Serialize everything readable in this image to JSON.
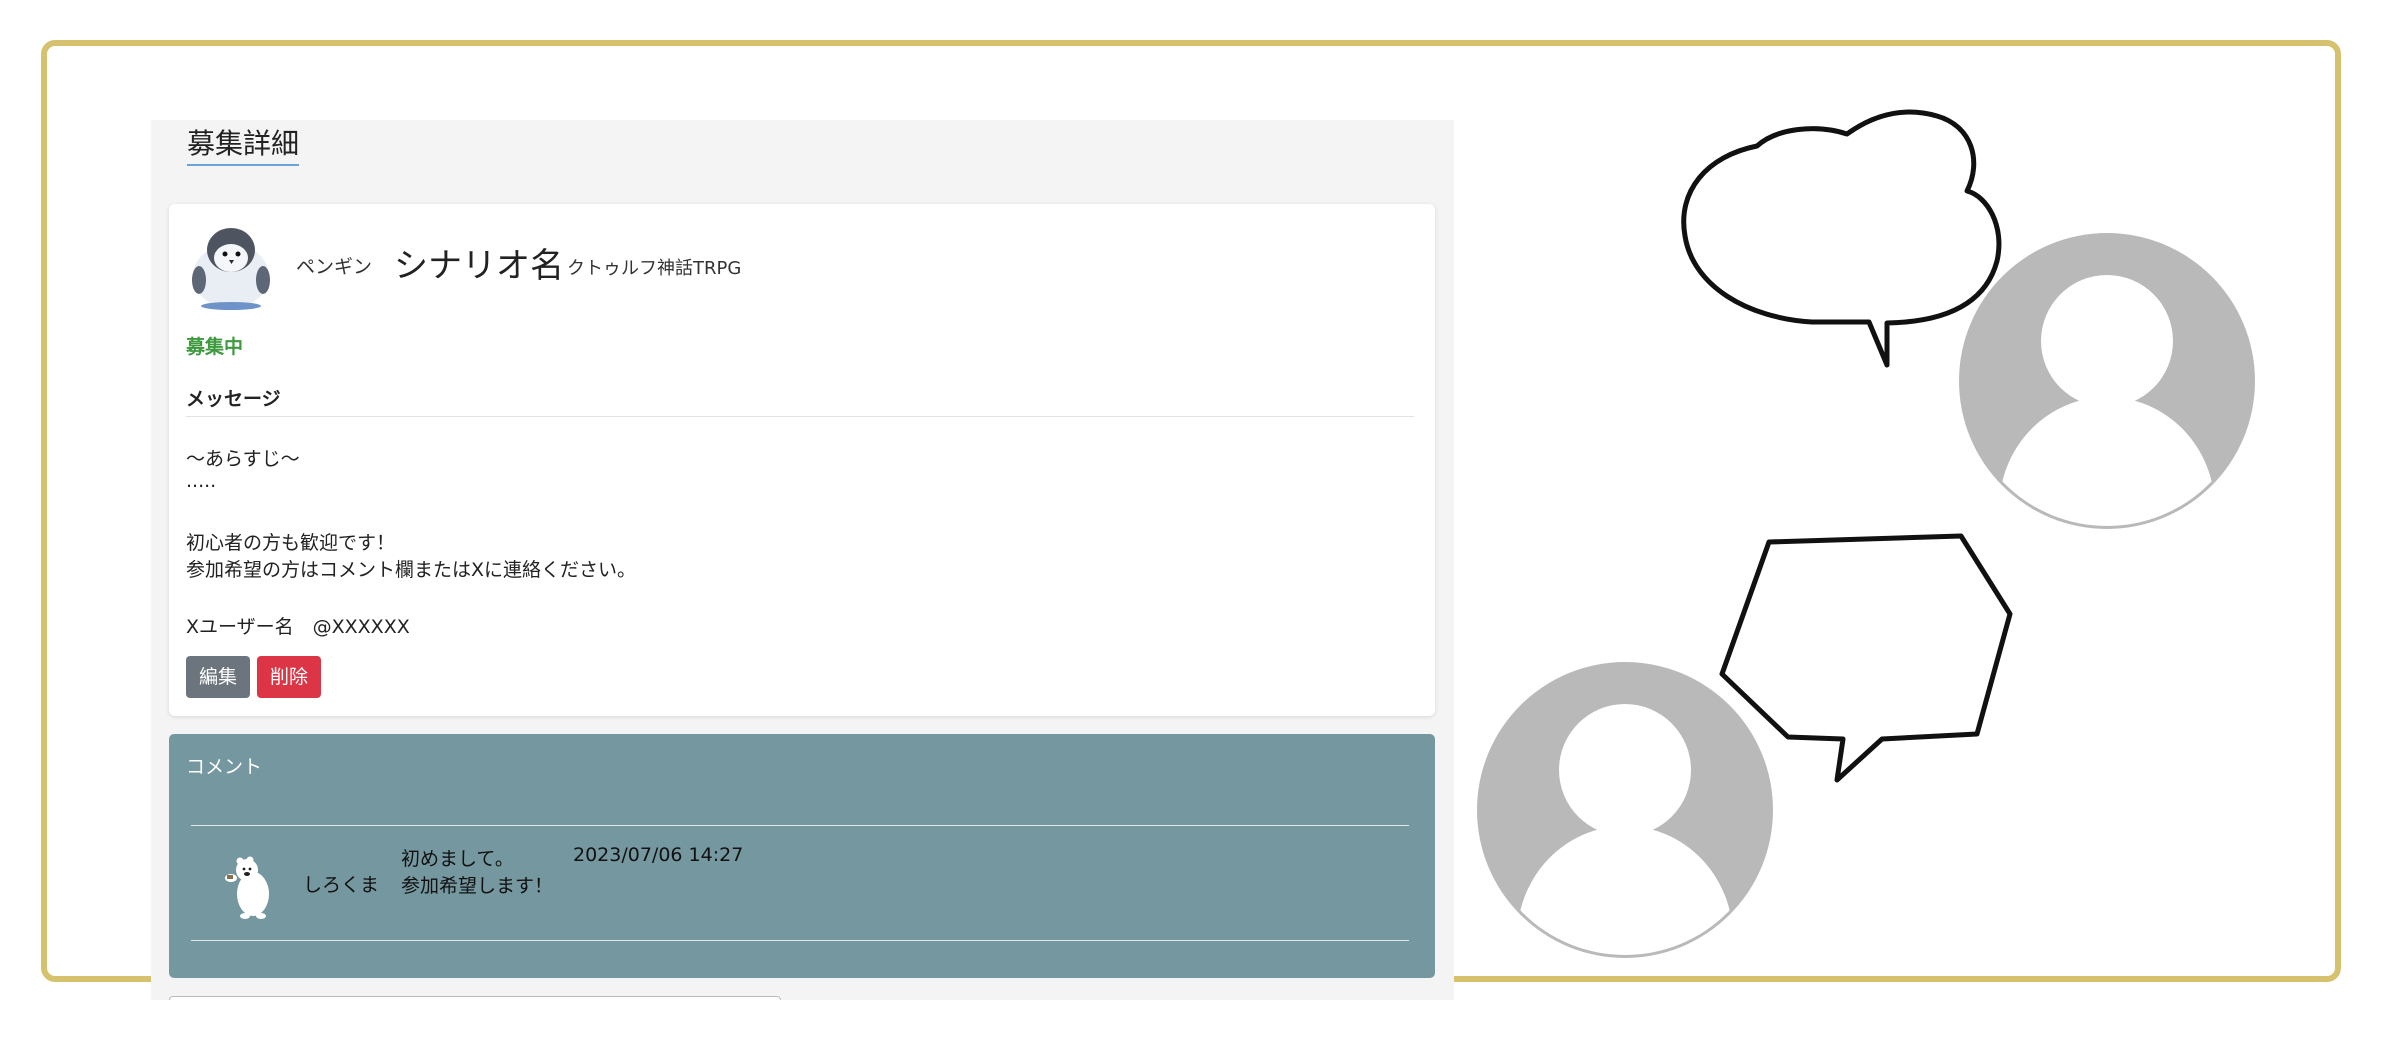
{
  "page": {
    "title": "募集詳細"
  },
  "post": {
    "user_name": "ペンギン",
    "scenario": "シナリオ名",
    "system": "クトゥルフ神話TRPG",
    "status": "募集中",
    "message_heading": "メッセージ",
    "message_lines": [
      "〜あらすじ〜",
      ".....",
      "",
      "初心者の方も歓迎です！",
      "参加希望の方はコメント欄またはXに連絡ください。",
      "",
      "Xユーザー名　@XXXXXX"
    ],
    "edit_label": "編集",
    "delete_label": "削除"
  },
  "comments": {
    "title": "コメント",
    "items": [
      {
        "user": "しろくま",
        "lines": [
          "初めまして。",
          "参加希望します！"
        ],
        "time": "2023/07/06 14:27"
      }
    ]
  },
  "colors": {
    "frame": "#d6c16f",
    "status": "#3f9a3f",
    "comment_bg": "#75979f",
    "edit_btn": "#6c757d",
    "delete_btn": "#dc3545"
  }
}
